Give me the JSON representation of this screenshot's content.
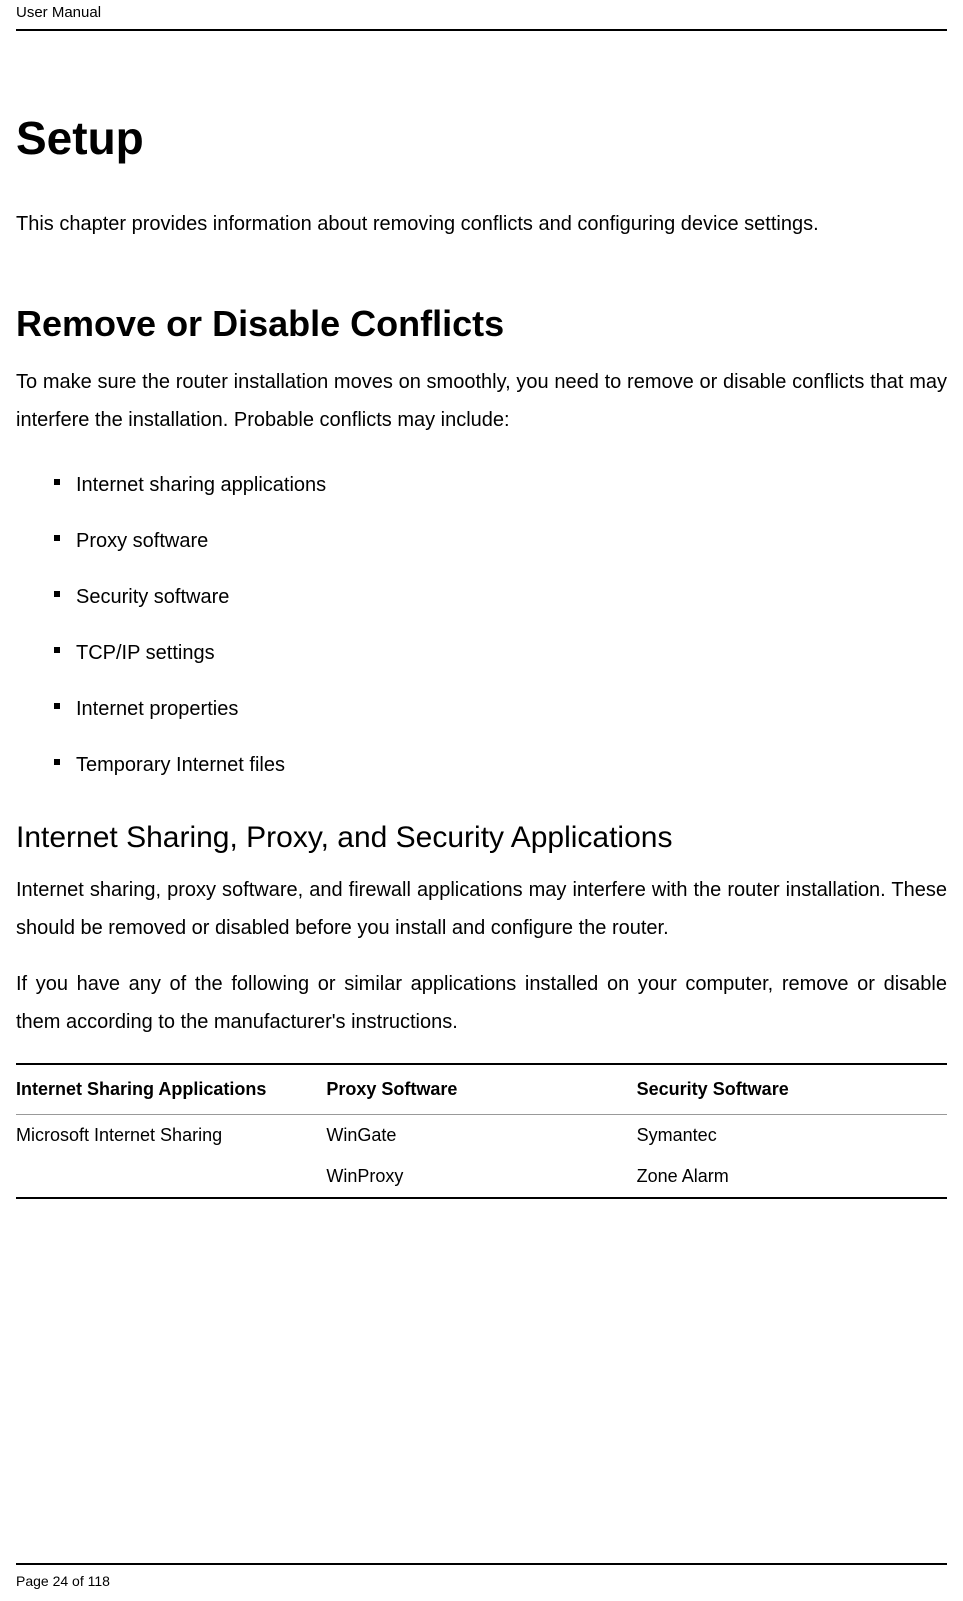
{
  "header": {
    "title": "User Manual"
  },
  "section": {
    "h1": "Setup",
    "intro": "This chapter provides information about removing conflicts and configuring device settings.",
    "h2": "Remove or Disable Conflicts",
    "para1": "To make sure the router installation moves on smoothly, you need to remove or disable conflicts that may interfere the installation. Probable conflicts may include:",
    "bullets": [
      "Internet sharing applications",
      "Proxy software",
      "Security software",
      "TCP/IP settings",
      "Internet properties",
      "Temporary Internet files"
    ],
    "h3": "Internet Sharing, Proxy, and Security Applications",
    "para2": "Internet sharing, proxy software, and firewall applications may interfere with the router installation. These should be removed or disabled before you install and configure the router.",
    "para3": "If you have any of the following or similar applications installed on your computer, remove or disable them according to the manufacturer's instructions."
  },
  "table": {
    "headers": [
      "Internet Sharing Applications",
      "Proxy Software",
      "Security Software"
    ],
    "rows": [
      [
        "Microsoft Internet Sharing",
        "WinGate",
        "Symantec"
      ],
      [
        "",
        "WinProxy",
        "Zone Alarm"
      ]
    ]
  },
  "footer": {
    "page_label": "Page 24 of 118"
  }
}
